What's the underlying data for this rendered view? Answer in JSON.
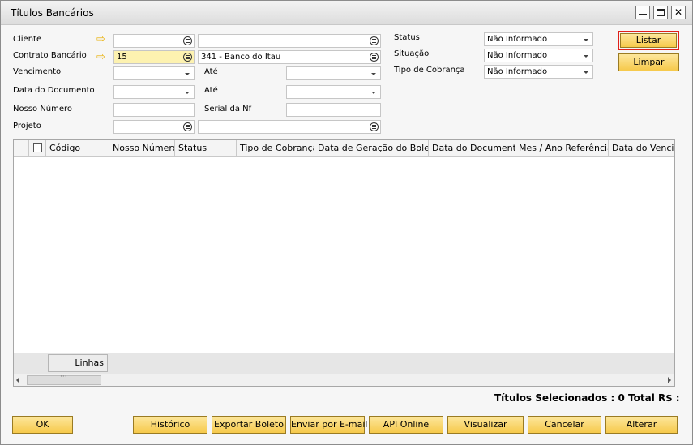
{
  "window": {
    "title": "Títulos Bancários"
  },
  "colors": {
    "accent": "#f6c94b",
    "highlight_field": "#fdf2b0",
    "focus_border": "#e0201a"
  },
  "filters": {
    "cliente": {
      "label": "Cliente",
      "code": "",
      "name": ""
    },
    "contrato": {
      "label": "Contrato Bancário",
      "code": "15",
      "name": "341 - Banco do Itau"
    },
    "vencimento": {
      "label": "Vencimento",
      "from": "",
      "ate_label": "Até",
      "to": ""
    },
    "data_documento": {
      "label": "Data do Documento",
      "from": "",
      "ate_label": "Até",
      "to": ""
    },
    "nosso_numero": {
      "label": "Nosso Número",
      "value": ""
    },
    "serial_nf": {
      "label": "Serial da Nf",
      "value": ""
    },
    "projeto": {
      "label": "Projeto",
      "code": "",
      "name": ""
    },
    "status": {
      "label": "Status",
      "value": "Não Informado"
    },
    "situacao": {
      "label": "Situação",
      "value": "Não Informado"
    },
    "tipo_cobranca": {
      "label": "Tipo de Cobrança",
      "value": "Não Informado"
    }
  },
  "actions": {
    "listar": "Listar",
    "limpar": "Limpar"
  },
  "grid": {
    "columns": [
      "Código",
      "Nosso Número",
      "Status",
      "Tipo de Cobrança",
      "Data de Geração do Boleto",
      "Data do Documento",
      "Mes / Ano Referência",
      "Data do Vencime"
    ],
    "footer_label": "Linhas"
  },
  "summary": "Títulos Selecionados : 0 Total R$ :",
  "buttons": {
    "ok": "OK",
    "historico": "Histórico",
    "exportar": "Exportar Boleto",
    "email": "Enviar por E-mail",
    "api": "API Online",
    "visualizar": "Visualizar",
    "cancelar": "Cancelar",
    "alterar": "Alterar"
  }
}
